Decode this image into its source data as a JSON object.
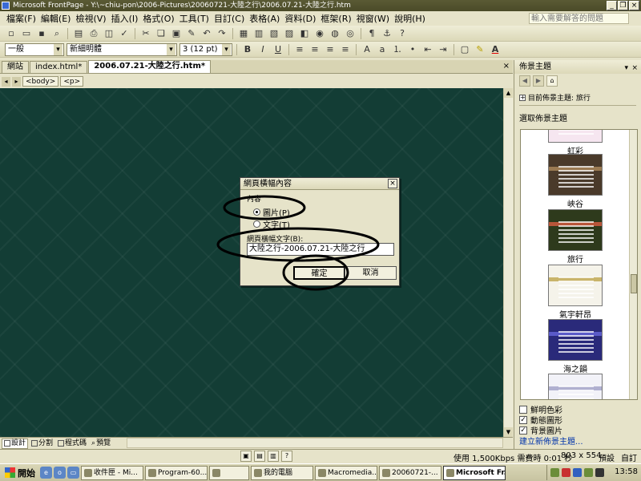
{
  "window": {
    "title": "Microsoft FrontPage - Y:\\~chiu-pon\\2006-Pictures\\20060721-大陸之行\\2006.07.21-大陸之行.htm",
    "controls": [
      "_",
      "❐",
      "×"
    ]
  },
  "menu": {
    "items": [
      "檔案(F)",
      "編輯(E)",
      "檢視(V)",
      "插入(I)",
      "格式(O)",
      "工具(T)",
      "目訂(C)",
      "表格(A)",
      "資料(D)",
      "框架(R)",
      "視窗(W)",
      "說明(H)"
    ],
    "help_placeholder": "輸入需要解答的問題"
  },
  "format_toolbar": {
    "style_value": "一般",
    "font_value": "新細明體",
    "size_value": "3  (12 pt)",
    "bold": "B",
    "italic": "I",
    "underline": "U",
    "font_color_label": "A"
  },
  "doc_tabs": [
    "網站",
    "index.html*",
    "2006.07.21-大陸之行.htm*"
  ],
  "tag_selector": [
    "<body>",
    "<p>"
  ],
  "dialog": {
    "title": "網頁橫幅內容",
    "group_label": "內容",
    "options": [
      "圖片(P)",
      "文字(T)"
    ],
    "selected_option": "圖片(P)",
    "field_label": "網頁橫幅文字(B):",
    "field_value": "大陸之行-2006.07.21-大陸之行",
    "ok": "確定",
    "cancel": "取消"
  },
  "view_tabs": [
    "設計",
    "分割",
    "程式碼",
    "預覽"
  ],
  "task_pane": {
    "title": "佈景主題",
    "current_theme": "目前佈景主題: 旅行",
    "select_label": "選取佈景主題",
    "themes": [
      {
        "name": "虹彩",
        "colors": [
          "#f6e6f0",
          "#b05a9a"
        ]
      },
      {
        "name": "峽谷",
        "colors": [
          "#4a3a2a",
          "#9a7a52"
        ]
      },
      {
        "name": "旅行",
        "colors": [
          "#2e3a1c",
          "#b8563a"
        ]
      },
      {
        "name": "氣宇軒昂",
        "colors": [
          "#f5f3ea",
          "#c9b46a"
        ]
      },
      {
        "name": "海之韻",
        "colors": [
          "#2a2a7a",
          "#5a5ac8"
        ]
      },
      {
        "name": "",
        "colors": [
          "#f2f2f8",
          "#b0b0d0"
        ]
      }
    ],
    "options": [
      {
        "label": "鮮明色彩",
        "checked": false
      },
      {
        "label": "動態圖形",
        "checked": true
      },
      {
        "label": "背景圖片",
        "checked": true
      }
    ],
    "new_theme_link": "建立新佈景主題..."
  },
  "status": {
    "connection": "使用 1,500Kbps 需費時 0:01 秒",
    "dimensions": "803 x 554",
    "mode": "預設",
    "custom": "自訂"
  },
  "taskbar": {
    "start": "開始",
    "buttons": [
      "收件匣 - Mi...",
      "Program-60...",
      "",
      "我的電腦",
      "Macromedia...",
      "20060721-...",
      "Microsoft Fr..."
    ],
    "active_button": "Microsoft Fr...",
    "clock": "13:58"
  }
}
